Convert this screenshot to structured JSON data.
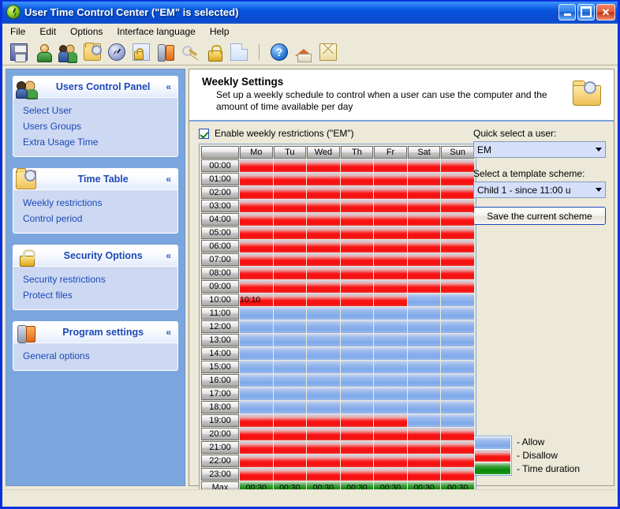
{
  "window": {
    "title": "User Time Control Center (\"EM\" is selected)",
    "app_icon": "clock-icon",
    "minimize_label": "Minimize",
    "maximize_label": "Maximize",
    "close_label": "Close"
  },
  "menubar": {
    "items": [
      {
        "label": "File"
      },
      {
        "label": "Edit"
      },
      {
        "label": "Options"
      },
      {
        "label": "Interface language"
      },
      {
        "label": "Help"
      }
    ]
  },
  "toolbar": {
    "buttons": [
      {
        "icon": "save-icon"
      },
      {
        "icon": "user-icon"
      },
      {
        "icon": "users-icon"
      },
      {
        "icon": "folder-search-icon"
      },
      {
        "icon": "clock-icon"
      },
      {
        "icon": "locked-document-icon"
      },
      {
        "icon": "tools-icon"
      },
      {
        "icon": "keys-icon"
      },
      {
        "icon": "padlock-icon"
      },
      {
        "icon": "blank-document-icon"
      },
      {
        "icon": "separator"
      },
      {
        "icon": "help-icon"
      },
      {
        "icon": "home-icon"
      },
      {
        "icon": "mail-icon"
      }
    ]
  },
  "sidebar": {
    "panels": [
      {
        "title": "Users Control Panel",
        "icon": "users-icon",
        "collapse_glyph": "«",
        "links": [
          {
            "label": "Select User"
          },
          {
            "label": "Users Groups"
          },
          {
            "label": "Extra Usage Time"
          }
        ]
      },
      {
        "title": "Time Table",
        "icon": "folder-search-icon",
        "collapse_glyph": "«",
        "links": [
          {
            "label": "Weekly restrictions"
          },
          {
            "label": "Control period"
          }
        ]
      },
      {
        "title": "Security Options",
        "icon": "padlock-icon",
        "collapse_glyph": "«",
        "links": [
          {
            "label": "Security restrictions"
          },
          {
            "label": "Protect files"
          }
        ]
      },
      {
        "title": "Program settings",
        "icon": "tools-icon",
        "collapse_glyph": "«",
        "links": [
          {
            "label": "General options"
          }
        ]
      }
    ]
  },
  "main": {
    "header": {
      "title": "Weekly Settings",
      "subtitle": "Set up a weekly schedule to control when a user can use the computer and the amount of time available per day",
      "icon": "folder-search-icon"
    },
    "enable_checkbox": {
      "label": "Enable weekly restrictions (\"EM\")",
      "checked": true
    },
    "quick_select": {
      "label": "Quick select a user:",
      "value": "EM"
    },
    "template_scheme": {
      "label": "Select a template scheme:",
      "value": "Child 1  - since 11:00 u"
    },
    "save_button": {
      "label": "Save the current scheme"
    },
    "legend": {
      "items": [
        {
          "swatch": "allow",
          "label": "- Allow"
        },
        {
          "swatch": "disallow",
          "label": "- Disallow"
        },
        {
          "swatch": "dur",
          "label": "- Time duration"
        }
      ]
    }
  },
  "chart_data": {
    "type": "heatmap",
    "title": "Weekly Settings",
    "xlabel": "",
    "ylabel": "",
    "corner_label": "",
    "categories": [
      "Mo",
      "Tu",
      "Wed",
      "Th",
      "Fr",
      "Sat",
      "Sun"
    ],
    "rows": [
      {
        "hour": "00:00",
        "states": [
          "disallow",
          "disallow",
          "disallow",
          "disallow",
          "disallow",
          "disallow",
          "disallow"
        ]
      },
      {
        "hour": "01:00",
        "states": [
          "disallow",
          "disallow",
          "disallow",
          "disallow",
          "disallow",
          "disallow",
          "disallow"
        ]
      },
      {
        "hour": "02:00",
        "states": [
          "disallow",
          "disallow",
          "disallow",
          "disallow",
          "disallow",
          "disallow",
          "disallow"
        ]
      },
      {
        "hour": "03:00",
        "states": [
          "disallow",
          "disallow",
          "disallow",
          "disallow",
          "disallow",
          "disallow",
          "disallow"
        ]
      },
      {
        "hour": "04:00",
        "states": [
          "disallow",
          "disallow",
          "disallow",
          "disallow",
          "disallow",
          "disallow",
          "disallow"
        ]
      },
      {
        "hour": "05:00",
        "states": [
          "disallow",
          "disallow",
          "disallow",
          "disallow",
          "disallow",
          "disallow",
          "disallow"
        ]
      },
      {
        "hour": "06:00",
        "states": [
          "disallow",
          "disallow",
          "disallow",
          "disallow",
          "disallow",
          "disallow",
          "disallow"
        ]
      },
      {
        "hour": "07:00",
        "states": [
          "disallow",
          "disallow",
          "disallow",
          "disallow",
          "disallow",
          "disallow",
          "disallow"
        ]
      },
      {
        "hour": "08:00",
        "states": [
          "disallow",
          "disallow",
          "disallow",
          "disallow",
          "disallow",
          "disallow",
          "disallow"
        ]
      },
      {
        "hour": "09:00",
        "states": [
          "disallow",
          "disallow",
          "disallow",
          "disallow",
          "disallow",
          "disallow",
          "disallow"
        ]
      },
      {
        "hour": "10:00",
        "states": [
          "disallow",
          "disallow",
          "disallow",
          "disallow",
          "disallow",
          "allow",
          "allow"
        ],
        "labels": [
          "10:10",
          "",
          "",
          "",
          "",
          "",
          ""
        ]
      },
      {
        "hour": "11:00",
        "states": [
          "allow",
          "allow",
          "allow",
          "allow",
          "allow",
          "allow",
          "allow"
        ]
      },
      {
        "hour": "12:00",
        "states": [
          "allow",
          "allow",
          "allow",
          "allow",
          "allow",
          "allow",
          "allow"
        ]
      },
      {
        "hour": "13:00",
        "states": [
          "allow",
          "allow",
          "allow",
          "allow",
          "allow",
          "allow",
          "allow"
        ]
      },
      {
        "hour": "14:00",
        "states": [
          "allow",
          "allow",
          "allow",
          "allow",
          "allow",
          "allow",
          "allow"
        ]
      },
      {
        "hour": "15:00",
        "states": [
          "allow",
          "allow",
          "allow",
          "allow",
          "allow",
          "allow",
          "allow"
        ]
      },
      {
        "hour": "16:00",
        "states": [
          "allow",
          "allow",
          "allow",
          "allow",
          "allow",
          "allow",
          "allow"
        ]
      },
      {
        "hour": "17:00",
        "states": [
          "allow",
          "allow",
          "allow",
          "allow",
          "allow",
          "allow",
          "allow"
        ]
      },
      {
        "hour": "18:00",
        "states": [
          "allow",
          "allow",
          "allow",
          "allow",
          "allow",
          "allow",
          "allow"
        ]
      },
      {
        "hour": "19:00",
        "states": [
          "disallow",
          "disallow",
          "disallow",
          "disallow",
          "disallow",
          "allow",
          "allow"
        ]
      },
      {
        "hour": "20:00",
        "states": [
          "disallow",
          "disallow",
          "disallow",
          "disallow",
          "disallow",
          "disallow",
          "disallow"
        ]
      },
      {
        "hour": "21:00",
        "states": [
          "disallow",
          "disallow",
          "disallow",
          "disallow",
          "disallow",
          "disallow",
          "disallow"
        ]
      },
      {
        "hour": "22:00",
        "states": [
          "disallow",
          "disallow",
          "disallow",
          "disallow",
          "disallow",
          "disallow",
          "disallow"
        ]
      },
      {
        "hour": "23:00",
        "states": [
          "disallow",
          "disallow",
          "disallow",
          "disallow",
          "disallow",
          "disallow",
          "disallow"
        ]
      }
    ],
    "max_row": {
      "label": "Max",
      "values": [
        "00:30",
        "00:30",
        "00:30",
        "00:30",
        "00:30",
        "00:30",
        "00:30"
      ]
    },
    "colors": {
      "allow": "#7ea9ea",
      "disallow": "#fb1414",
      "duration": "#0a8a0a"
    },
    "legend": [
      "- Allow",
      "- Disallow",
      "- Time duration"
    ]
  }
}
